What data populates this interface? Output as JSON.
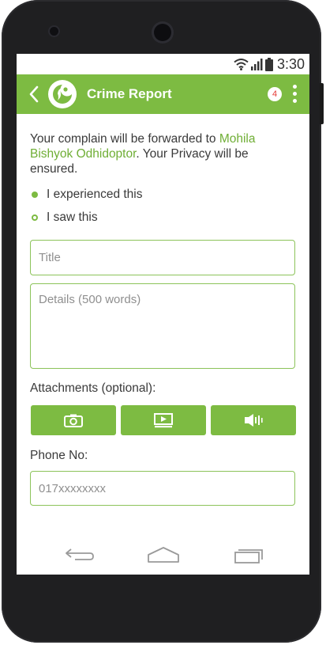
{
  "status_bar": {
    "time": "3:30",
    "icons": [
      "wifi-icon",
      "signal-icon",
      "battery-icon"
    ]
  },
  "app_bar": {
    "title": "Crime Report",
    "notification_count": "4",
    "icons": [
      "back-arrow-icon",
      "app-logo-icon",
      "more-vert-icon"
    ]
  },
  "notice": {
    "text_before": "Your complain will be forwarded to ",
    "highlight": "Mohila Bishyok Odhidoptor",
    "text_after": ". Your Privacy will be ensured."
  },
  "report_type": {
    "options": [
      {
        "label": "I experienced this",
        "selected": true
      },
      {
        "label": "I saw this",
        "selected": false
      }
    ]
  },
  "form": {
    "title_placeholder": "Title",
    "details_placeholder": "Details (500 words)",
    "attachments_label": "Attachments (optional):",
    "attachment_buttons": [
      "camera-icon",
      "video-icon",
      "audio-icon"
    ],
    "phone_label": "Phone No:",
    "phone_placeholder": "017xxxxxxxx"
  },
  "nav_bar": {
    "icons": [
      "nav-back-icon",
      "nav-home-icon",
      "nav-recents-icon"
    ]
  },
  "colors": {
    "accent": "#7dbb42",
    "badge_text": "#e53935",
    "phone_body": "#1f1f21",
    "text": "#3a3a3a"
  }
}
